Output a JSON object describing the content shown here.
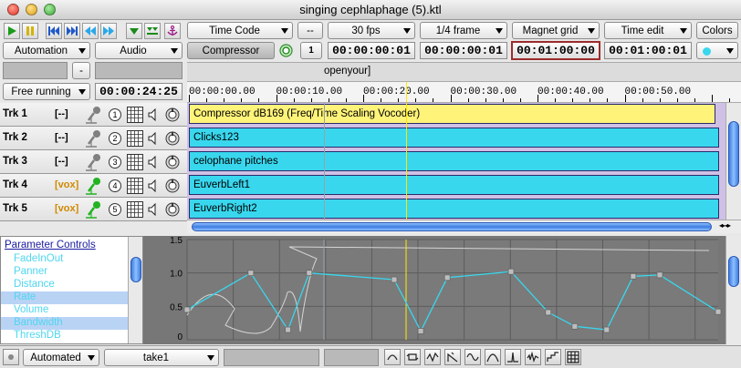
{
  "window": {
    "title": "singing cephlaphage (5).ktl"
  },
  "transport": {
    "icons": [
      "play-icon",
      "pause-icon",
      "rewind-to-start-icon",
      "step-forward-icon",
      "rewind-icon",
      "fast-forward-icon",
      "down-arrow-icon",
      "double-down-arrow-icon",
      "anchor-icon"
    ]
  },
  "toolbar": {
    "timecode_mode": "Time Code",
    "dash_label": "-- ",
    "fps": "30 fps",
    "frame_snap": "1/4 frame",
    "magnet": "Magnet grid",
    "time_edit": "Time edit",
    "colors_label": "Colors",
    "automation": "Automation",
    "audio": "Audio",
    "plugin_name": "Compressor",
    "channel_number": "1",
    "tc_current": "00:00:00:01",
    "tc_start": "00:00:00:01",
    "tc_length": "00:01:00:00",
    "tc_end": "00:01:00:01",
    "minus_label": "-",
    "marker_text": "openyour]",
    "sync_mode": "Free running",
    "sync_time": "00:00:24:25"
  },
  "ruler": {
    "labels": [
      "00:00:00.00",
      "00:00:10.00",
      "00:00:20.00",
      "00:00:30.00",
      "00:00:40.00",
      "00:00:50.00"
    ]
  },
  "tracks": [
    {
      "name": "Trk 1",
      "group": "[--]",
      "number": "1",
      "region": "Compressor dB169 (Freq/Time Scaling Vocoder)",
      "region_color": "#fff37a",
      "armed": false
    },
    {
      "name": "Trk 2",
      "group": "[--]",
      "number": "2",
      "region": "Clicks123",
      "region_color": "#39d7ee",
      "armed": false
    },
    {
      "name": "Trk 3",
      "group": "[--]",
      "number": "3",
      "region": "celophane pitches",
      "region_color": "#39d7ee",
      "armed": false
    },
    {
      "name": "Trk 4",
      "group": "[vox]",
      "number": "4",
      "region": "EuverbLeft1",
      "region_color": "#39d7ee",
      "armed": true
    },
    {
      "name": "Trk 5",
      "group": "[vox]",
      "number": "5",
      "region": "EuverbRight2",
      "region_color": "#39d7ee",
      "armed": true
    }
  ],
  "parameters": {
    "header": "Parameter Controls",
    "items": [
      "FadeInOut",
      "Panner",
      "Distance",
      "Rate",
      "Volume",
      "Bandwidth",
      "ThreshDB"
    ]
  },
  "automation_graph": {
    "y_ticks": [
      "1.5",
      "1.0",
      "0.5",
      "0"
    ],
    "ylim": [
      0,
      1.5
    ],
    "breakpoints": [
      [
        0,
        0.45
      ],
      [
        0.12,
        1.0
      ],
      [
        0.19,
        0.15
      ],
      [
        0.23,
        1.0
      ],
      [
        0.39,
        0.9
      ],
      [
        0.44,
        0.13
      ],
      [
        0.49,
        0.93
      ],
      [
        0.61,
        1.02
      ],
      [
        0.68,
        0.41
      ],
      [
        0.73,
        0.2
      ],
      [
        0.79,
        0.15
      ],
      [
        0.84,
        0.95
      ],
      [
        0.89,
        0.97
      ],
      [
        1.0,
        0.42
      ]
    ]
  },
  "bottombar": {
    "mode": "Automated",
    "take": "take1",
    "tool_icons": [
      "fade-curve-icon",
      "loop-icon",
      "random-icon",
      "ramp-icon",
      "sine-icon",
      "bell-icon",
      "spike-icon",
      "noise-icon",
      "steps-icon",
      "grid-snap-icon"
    ]
  },
  "colors": {
    "region_cyan": "#39d7ee",
    "region_yellow": "#fff37a",
    "playhead": "#ffea00",
    "lane_bg": "#cfc1e6"
  }
}
